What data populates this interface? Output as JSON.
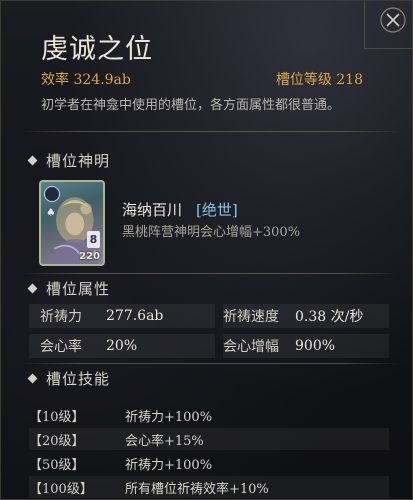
{
  "panel": {
    "title": "虔诚之位",
    "efficiency_label": "效率 324.9ab",
    "slot_level_label": "槽位等级 218",
    "description": "初学者在神龛中使用的槽位，各方面属性都很普通。",
    "close_icon": "close-x-icon"
  },
  "sections": {
    "deity": "槽位神明",
    "attributes": "槽位属性",
    "skills": "槽位技能"
  },
  "deity": {
    "name": "海纳百川",
    "rarity": "[绝世]",
    "effect": "黑桃阵营神明会心增幅+300%",
    "card_rank": "8",
    "card_level": "220",
    "card_suit": "♠"
  },
  "attributes": [
    {
      "k1": "祈祷力",
      "v1": "277.6ab",
      "k2": "祈祷速度",
      "v2": "0.38 次/秒"
    },
    {
      "k1": "会心率",
      "v1": "20%",
      "k2": "会心增幅",
      "v2": "900%"
    }
  ],
  "skills": [
    {
      "level": "【10级】",
      "effect": "祈祷力+100%"
    },
    {
      "level": "【20级】",
      "effect": "会心率+15%"
    },
    {
      "level": "【50级】",
      "effect": "祈祷力+100%"
    },
    {
      "level": "【100级】",
      "effect": "所有槽位祈祷效率+10%"
    }
  ],
  "colors": {
    "accent_gold": "#d9a64a",
    "rarity_blue": "#8ac4ec"
  }
}
